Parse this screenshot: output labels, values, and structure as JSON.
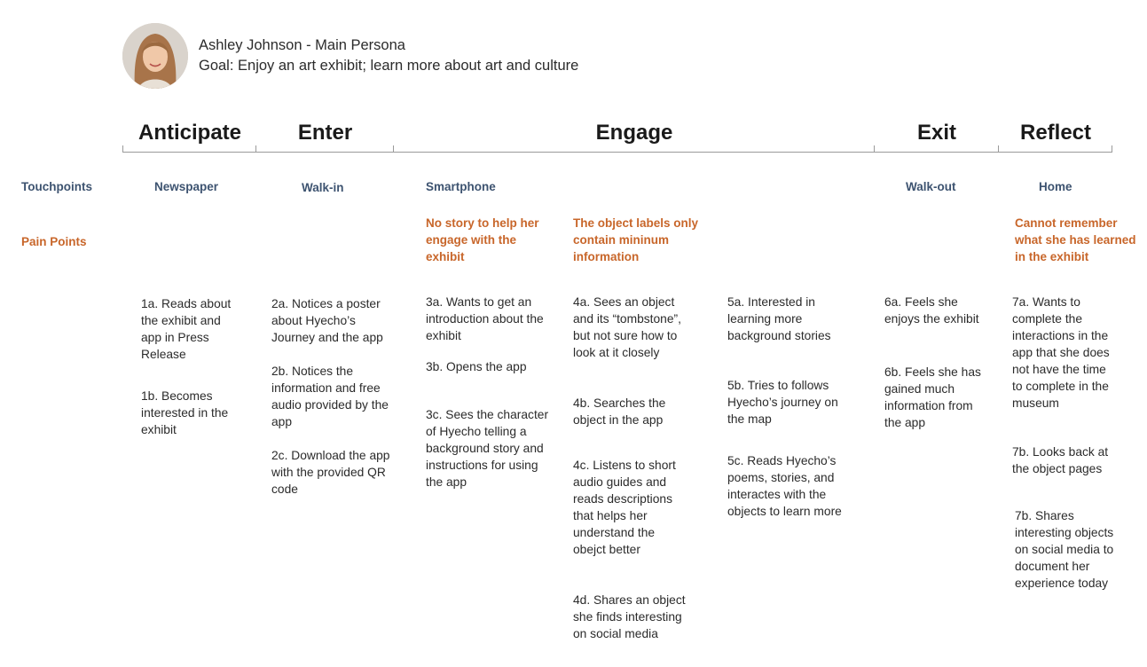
{
  "persona": {
    "name": "Ashley Johnson - Main Persona",
    "goal": "Goal: Enjoy an art exhibit; learn more about art and culture"
  },
  "stages": {
    "anticipate": "Anticipate",
    "enter": "Enter",
    "engage": "Engage",
    "exit": "Exit",
    "reflect": "Reflect"
  },
  "row_labels": {
    "touchpoints": "Touchpoints",
    "pain_points": "Pain Points"
  },
  "touchpoints": {
    "anticipate": "Newspaper",
    "enter": "Walk-in",
    "engage": "Smartphone",
    "exit": "Walk-out",
    "reflect": "Home"
  },
  "pain_points": {
    "engage_a": "No story to help her engage with the exhibit",
    "engage_b": "The object labels only contain mininum information",
    "reflect": "Cannot remember what she has learned in the exhibit"
  },
  "steps": {
    "s1a": "1a. Reads about the exhibit and app in Press Release",
    "s1b": "1b. Becomes interested in the exhibit",
    "s2a": "2a. Notices a poster about Hyecho’s Journey and the app",
    "s2b": "2b. Notices the information and free audio provided by the app",
    "s2c": "2c. Download the app with the provided QR code",
    "s3a": "3a. Wants to get an introduction about the exhibit",
    "s3b": "3b. Opens the app",
    "s3c": "3c. Sees the character of Hyecho telling a background story and instructions for using the app",
    "s4a": "4a. Sees an object and its “tombstone”, but not sure how to look at it closely",
    "s4b": "4b. Searches the object in the app",
    "s4c": "4c. Listens to short audio guides and reads descriptions that helps her understand the obejct better",
    "s4d": "4d. Shares an object she finds interesting on social media",
    "s5a": "5a. Interested in learning more background stories",
    "s5b": "5b. Tries to follows Hyecho’s journey on the map",
    "s5c": "5c.  Reads Hyecho’s poems, stories, and interactes with the objects to learn more",
    "s6a": "6a. Feels she enjoys the exhibit",
    "s6b": "6b. Feels she has gained much information from the app",
    "s7a": "7a. Wants to complete the interactions in the app that she does not have the time to complete in the museum",
    "s7b": "7b. Looks back at the object pages",
    "s7c": "7b. Shares interesting objects on social media to document her experience today"
  }
}
